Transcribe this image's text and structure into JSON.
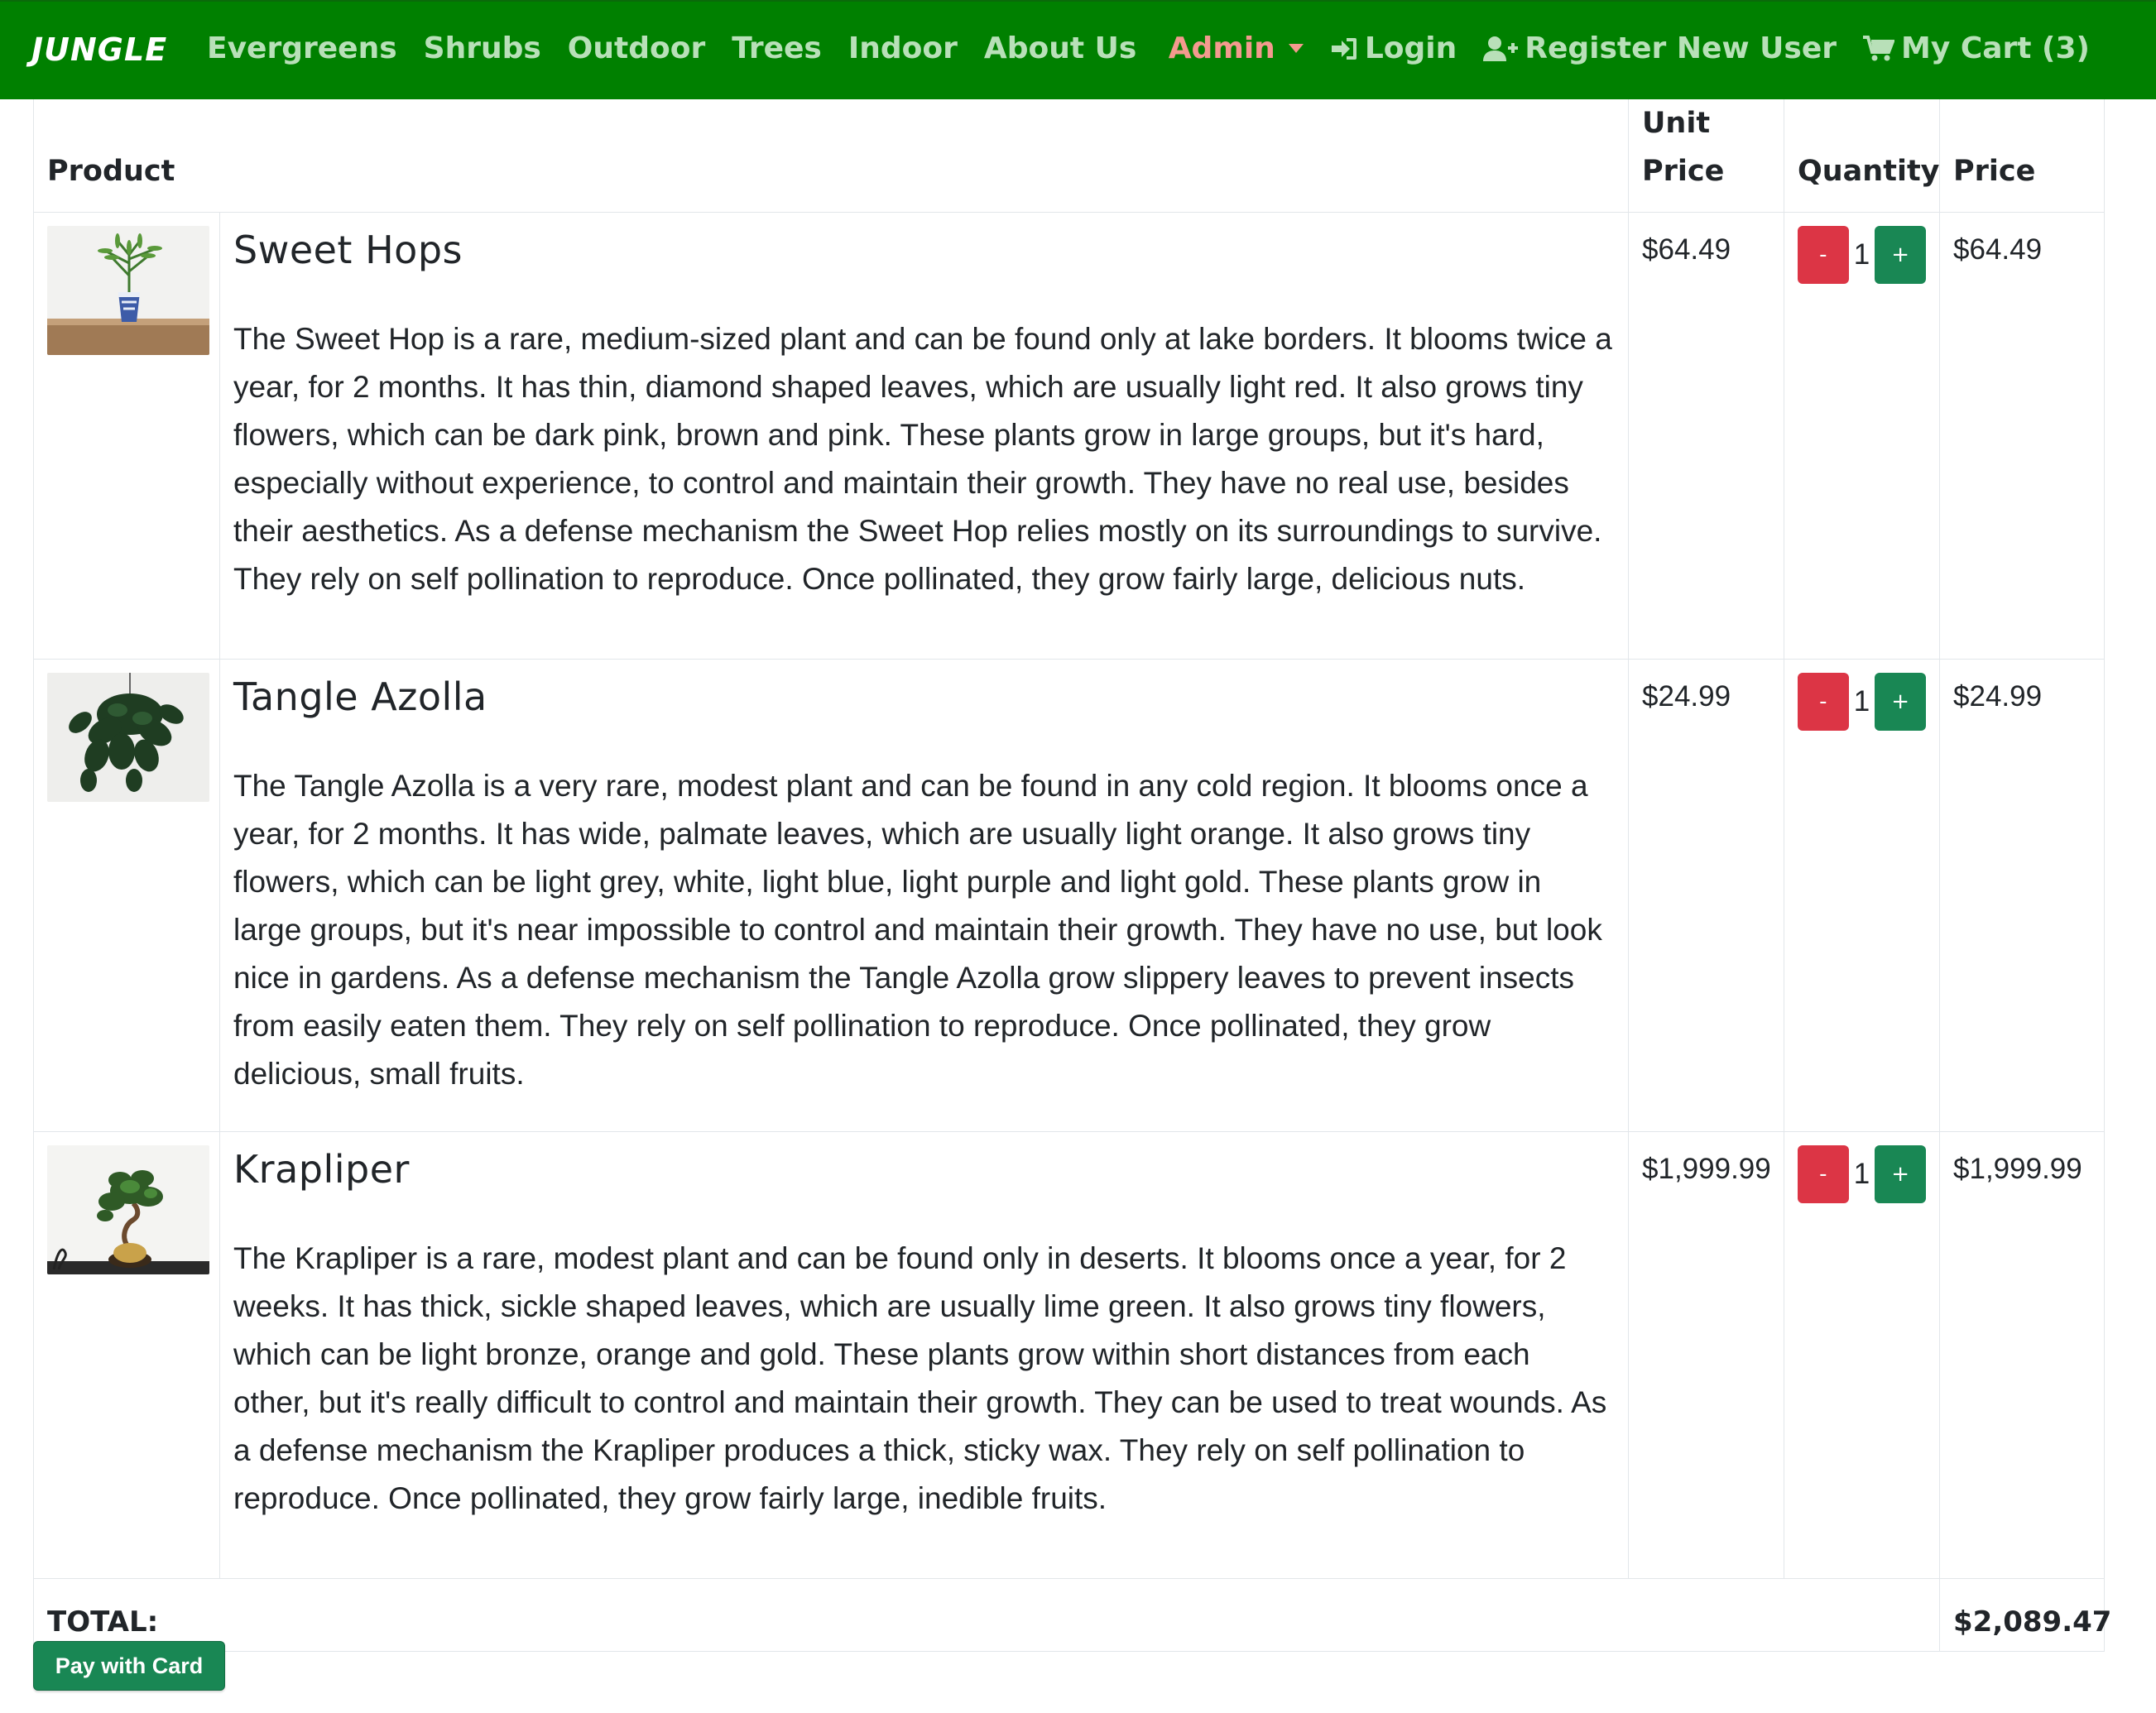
{
  "navbar": {
    "brand": "JUNGLE",
    "left_links": [
      "Evergreens",
      "Shrubs",
      "Outdoor",
      "Trees",
      "Indoor",
      "About Us"
    ],
    "admin_label": "Admin",
    "login_label": "Login",
    "register_label": "Register New User",
    "cart_label": "My Cart (3)",
    "bg_color": "#008000",
    "link_color": "#b8e0b8",
    "admin_color": "#f39a8e"
  },
  "table": {
    "headers": {
      "product": "Product",
      "unit_price": "Unit Price",
      "quantity": "Quantity",
      "price": "Price"
    },
    "items": [
      {
        "name": "Sweet Hops",
        "description": "The Sweet Hop is a rare, medium-sized plant and can be found only at lake borders. It blooms twice a year, for 2 months. It has thin, diamond shaped leaves, which are usually light red. It also grows tiny flowers, which can be dark pink, brown and pink. These plants grow in large groups, but it's hard, especially without experience, to control and maintain their growth. They have no real use, besides their aesthetics. As a defense mechanism the Sweet Hop relies mostly on its surroundings to survive. They rely on self pollination to reproduce. Once pollinated, they grow fairly large, delicious nuts.",
        "unit_price": "$64.49",
        "quantity": "1",
        "price": "$64.49",
        "image_icon": "potted-bamboo-plant-image"
      },
      {
        "name": "Tangle Azolla",
        "description": "The Tangle Azolla is a very rare, modest plant and can be found in any cold region. It blooms once a year, for 2 months. It has wide, palmate leaves, which are usually light orange. It also grows tiny flowers, which can be light grey, white, light blue, light purple and light gold. These plants grow in large groups, but it's near impossible to control and maintain their growth. They have no use, but look nice in gardens. As a defense mechanism the Tangle Azolla grow slippery leaves to prevent insects from easily eaten them. They rely on self pollination to reproduce. Once pollinated, they grow delicious, small fruits.",
        "unit_price": "$24.99",
        "quantity": "1",
        "price": "$24.99",
        "image_icon": "hanging-leafy-plant-image"
      },
      {
        "name": "Krapliper",
        "description": "The Krapliper is a rare, modest plant and can be found only in deserts. It blooms once a year, for 2 weeks. It has thick, sickle shaped leaves, which are usually lime green. It also grows tiny flowers, which can be light bronze, orange and gold. These plants grow within short distances from each other, but it's really difficult to control and maintain their growth. They can be used to treat wounds. As a defense mechanism the Krapliper produces a thick, sticky wax. They rely on self pollination to reproduce. Once pollinated, they grow fairly large, inedible fruits.",
        "unit_price": "$1,999.99",
        "quantity": "1",
        "price": "$1,999.99",
        "image_icon": "bonsai-plant-image"
      }
    ],
    "minus_label": "-",
    "plus_label": "+",
    "total_label": "TOTAL:",
    "total_value": "$2,089.47"
  },
  "pay_button": "Pay with Card",
  "colors": {
    "minus_button": "#dc3545",
    "plus_button": "#198754",
    "pay_button": "#198754"
  }
}
